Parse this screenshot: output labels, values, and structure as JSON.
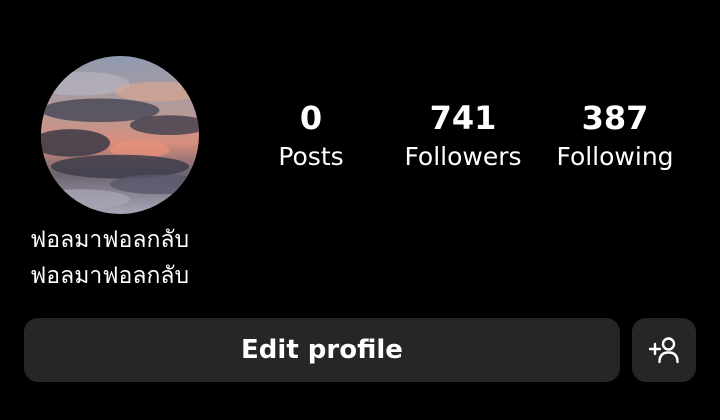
{
  "profile": {
    "avatar": {
      "alt": "profile-photo-cloudy-sunset-sky"
    },
    "stats": [
      {
        "count": "0",
        "label": "Posts"
      },
      {
        "count": "741",
        "label": "Followers"
      },
      {
        "count": "387",
        "label": "Following"
      }
    ],
    "bio_lines": [
      "ฟอลมาฟอลกลับ",
      "ฟอลมาฟอลกลับ"
    ]
  },
  "actions": {
    "edit_profile_label": "Edit profile",
    "add_user_icon": "add-person-icon"
  },
  "colors": {
    "background": "#000000",
    "button_bg": "#262626",
    "text": "#ffffff"
  }
}
